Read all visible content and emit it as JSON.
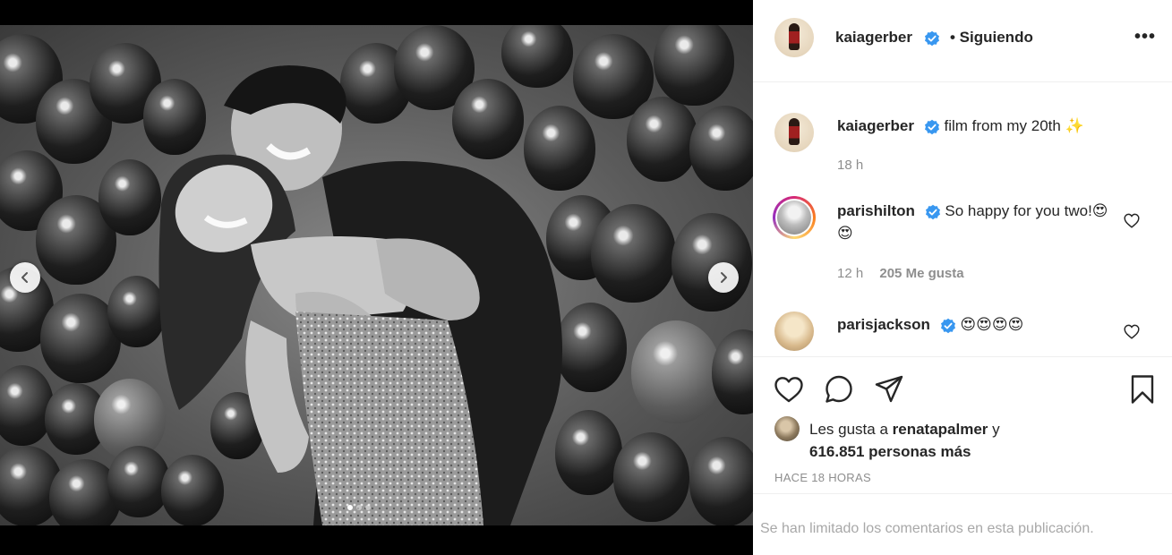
{
  "post": {
    "author": "kaiagerber",
    "follow_status": "• Siguiendo",
    "more_label": "•••",
    "caption_text": "film from my 20th ✨",
    "caption_time": "18 h",
    "likes_prefix": "Les gusta a",
    "likes_user": "renatapalmer",
    "likes_connector": " y",
    "likes_count": "616.851 personas más",
    "time_ago": "HACE 18 HORAS",
    "comments_limited": "Se han limitado los comentarios en esta publicación.",
    "carousel_total": 3,
    "carousel_index": 1
  },
  "comments": [
    {
      "username": "parishilton",
      "text": "So happy for you two!😍😍",
      "time": "12 h",
      "likes": "205 Me gusta"
    },
    {
      "username": "parisjackson",
      "text": "😍😍😍😍"
    }
  ],
  "icons": {
    "verified": "verified-badge-icon",
    "like": "heart-icon",
    "comment": "comment-bubble-icon",
    "share": "paper-plane-icon",
    "save": "bookmark-icon",
    "prev": "chevron-left-icon",
    "next": "chevron-right-icon"
  },
  "colors": {
    "verified_blue": "#3897f0",
    "text": "#262626",
    "secondary": "#8e8e8e"
  }
}
